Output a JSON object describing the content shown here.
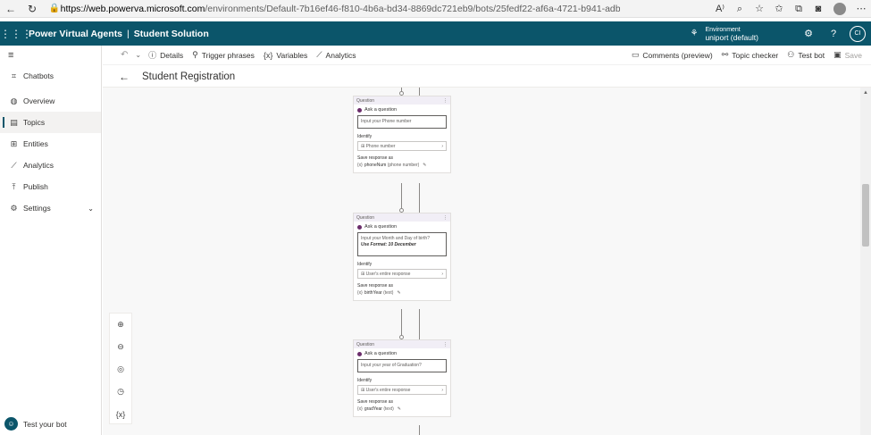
{
  "browser": {
    "back_icon": "back-arrow-icon",
    "refresh_icon": "refresh-icon",
    "url_host": "https://web.powerva.microsoft.com",
    "url_path": "/environments/Default-7b16ef46-f810-4b6a-bd34-8869dc721eb9/bots/25fedf22-af6a-4721-b941-adb8..."
  },
  "header": {
    "app_name": "Power Virtual Agents",
    "solution": "Student Solution",
    "env_label": "Environment",
    "env_name": "uniport (default)",
    "user_initials": "CI",
    "brand_color": "#0b556a"
  },
  "sidebar": {
    "items": [
      {
        "label": "Chatbots",
        "icon": "chatbots-icon"
      },
      {
        "label": "Overview",
        "icon": "overview-icon"
      },
      {
        "label": "Topics",
        "icon": "topics-icon"
      },
      {
        "label": "Entities",
        "icon": "entities-icon"
      },
      {
        "label": "Analytics",
        "icon": "analytics-icon"
      },
      {
        "label": "Publish",
        "icon": "publish-icon"
      },
      {
        "label": "Settings",
        "icon": "settings-icon"
      }
    ],
    "test_bot": "Test your bot"
  },
  "toolbar": {
    "details": "Details",
    "trigger_phrases": "Trigger phrases",
    "variables": "Variables",
    "analytics": "Analytics",
    "comments": "Comments (preview)",
    "topic_checker": "Topic checker",
    "test_bot": "Test bot",
    "save": "Save"
  },
  "page": {
    "title": "Student Registration"
  },
  "nodes": [
    {
      "header": "Question",
      "ask_label": "Ask a question",
      "question": "Input your Phone number",
      "format": "",
      "identify_label": "Identify",
      "identify_value": "Phone number",
      "save_label": "Save response as",
      "var_name": "phoneNum",
      "var_type": "(phone number)"
    },
    {
      "header": "Question",
      "ask_label": "Ask a question",
      "question": "Input your Month and Day of birth?",
      "format": "Use Format: 10 December",
      "identify_label": "Identify",
      "identify_value": "User's entire response",
      "save_label": "Save response as",
      "var_name": "birthYear",
      "var_type": "(text)"
    },
    {
      "header": "Question",
      "ask_label": "Ask a question",
      "question": "Input your year of Graduation?",
      "format": "",
      "identify_label": "Identify",
      "identify_value": "User's entire response",
      "save_label": "Save response as",
      "var_name": "gradYear",
      "var_type": "(text)"
    }
  ]
}
